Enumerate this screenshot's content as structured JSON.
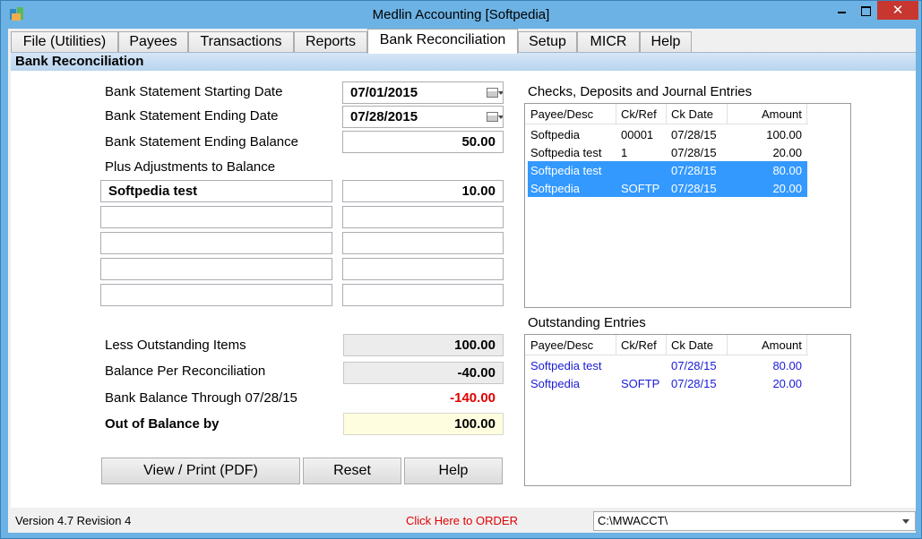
{
  "window": {
    "title": "Medlin Accounting [Softpedia]",
    "close_glyph": "✕"
  },
  "tabs": [
    {
      "label": "File (Utilities)"
    },
    {
      "label": "Payees"
    },
    {
      "label": "Transactions"
    },
    {
      "label": "Reports"
    },
    {
      "label": "Bank Reconciliation"
    },
    {
      "label": "Setup"
    },
    {
      "label": "MICR"
    },
    {
      "label": "Help"
    }
  ],
  "section": {
    "title": "Bank Reconciliation"
  },
  "form": {
    "start_date_label": "Bank Statement Starting Date",
    "start_date_value": "07/01/2015",
    "end_date_label": "Bank Statement Ending Date",
    "end_date_value": "07/28/2015",
    "end_balance_label": "Bank Statement Ending Balance",
    "end_balance_value": "50.00",
    "adjustments_label": "Plus Adjustments to Balance",
    "adjustments": [
      {
        "desc": "Softpedia test",
        "amount": "10.00"
      },
      {
        "desc": "",
        "amount": ""
      },
      {
        "desc": "",
        "amount": ""
      },
      {
        "desc": "",
        "amount": ""
      },
      {
        "desc": "",
        "amount": ""
      }
    ],
    "less_outstanding_label": "Less Outstanding Items",
    "less_outstanding_value": "100.00",
    "balance_per_recon_label": "Balance Per Reconciliation",
    "balance_per_recon_value": "-40.00",
    "bank_balance_label": "Bank Balance Through 07/28/15",
    "bank_balance_value": "-140.00",
    "out_of_balance_label": "Out of Balance by",
    "out_of_balance_value": "100.00"
  },
  "buttons": {
    "view_print": "View / Print (PDF)",
    "reset": "Reset",
    "help": "Help"
  },
  "entries": {
    "title": "Checks, Deposits and Journal Entries",
    "columns": [
      "Payee/Desc",
      "Ck/Ref",
      "Ck Date",
      "Amount"
    ],
    "rows": [
      {
        "payee": "Softpedia",
        "ref": "00001",
        "date": "07/28/15",
        "amount": "100.00",
        "selected": false
      },
      {
        "payee": "Softpedia test",
        "ref": "1",
        "date": "07/28/15",
        "amount": "20.00",
        "selected": false
      },
      {
        "payee": "Softpedia test",
        "ref": "",
        "date": "07/28/15",
        "amount": "80.00",
        "selected": true
      },
      {
        "payee": "Softpedia",
        "ref": "SOFTP",
        "date": "07/28/15",
        "amount": "20.00",
        "selected": true
      }
    ]
  },
  "outstanding": {
    "title": "Outstanding Entries",
    "columns": [
      "Payee/Desc",
      "Ck/Ref",
      "Ck Date",
      "Amount"
    ],
    "rows": [
      {
        "payee": "Softpedia test",
        "ref": "",
        "date": "07/28/15",
        "amount": "80.00"
      },
      {
        "payee": "Softpedia",
        "ref": "SOFTP",
        "date": "07/28/15",
        "amount": "20.00"
      }
    ]
  },
  "status": {
    "version": "Version 4.7 Revision 4",
    "order_link": "Click Here to ORDER",
    "path": "C:\\MWACCT\\"
  },
  "colors": {
    "selection": "#3399ff",
    "negative": "#e00000",
    "link": "#e00000",
    "outstanding_text": "#1a1ad6"
  }
}
